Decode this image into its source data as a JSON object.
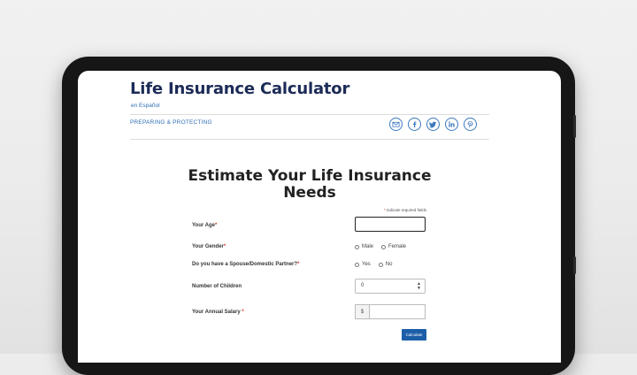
{
  "header": {
    "title": "Life Insurance Calculator",
    "language_link": "en Español",
    "section_link": "PREPARING & PROTECTING",
    "share_icons": [
      "email-icon",
      "facebook-icon",
      "twitter-icon",
      "linkedin-icon",
      "pinterest-icon"
    ]
  },
  "form": {
    "title": "Estimate Your Life Insurance Needs",
    "required_note": "indicate required fields",
    "age": {
      "label": "Your Age",
      "value": ""
    },
    "gender": {
      "label": "Your Gender",
      "options": [
        "Male",
        "Female"
      ]
    },
    "spouse": {
      "label": "Do you have a Spouse/Domestic Partner?",
      "options": [
        "Yes",
        "No"
      ]
    },
    "children": {
      "label": "Number of Children",
      "value": "0"
    },
    "salary": {
      "label": "Your Annual Salary",
      "prefix": "$",
      "value": ""
    },
    "submit_label": "Calculate"
  },
  "colors": {
    "title_navy": "#1c2b57",
    "link_blue": "#2f6db3",
    "required_red": "#d23a2a",
    "button_blue": "#1c5ea8"
  }
}
